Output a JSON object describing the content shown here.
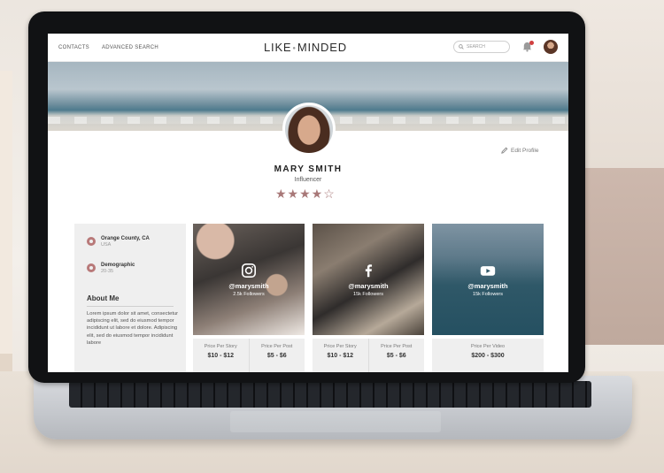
{
  "nav": {
    "links": [
      "CONTACTS",
      "ADVANCED SEARCH"
    ],
    "logo_left": "LIKE",
    "logo_right": "MINDED",
    "search_placeholder": "SEARCH"
  },
  "profile": {
    "edit_label": "Edit Profile",
    "name": "MARY SMITH",
    "role": "Influencer",
    "rating": 4,
    "rating_max": 5,
    "stars": "★★★★",
    "star_empty": "☆"
  },
  "sidebar": {
    "location": "Orange County, CA",
    "country": "USA",
    "demographic_label": "Demographic",
    "demographic_value": "20-35",
    "about_title": "About Me",
    "about_text": "Lorem ipsum dolor sit amet, consectetur adipiscing elit, sed do eiusmod tempor incididunt ut labore et dolore. Adipiscing elit, sed do eiusmod tempor incididunt labore"
  },
  "cards": {
    "instagram": {
      "handle": "@marysmith",
      "followers": "2.5k Followers",
      "price1_label": "Price Per Story",
      "price1_value": "$10 - $12",
      "price2_label": "Price Per Post",
      "price2_value": "$5 - $6"
    },
    "facebook": {
      "handle": "@marysmith",
      "followers": "15k Followers",
      "price1_label": "Price Per Story",
      "price1_value": "$10 - $12",
      "price2_label": "Price Per Post",
      "price2_value": "$5 - $6"
    },
    "youtube": {
      "handle": "@marysmith",
      "followers": "15k Followers",
      "price1_label": "Price Per Video",
      "price1_value": "$200 - $300"
    }
  },
  "colors": {
    "accent_rose": "#a87878",
    "icon_rose": "#b87979",
    "panel_grey": "#efefef"
  }
}
